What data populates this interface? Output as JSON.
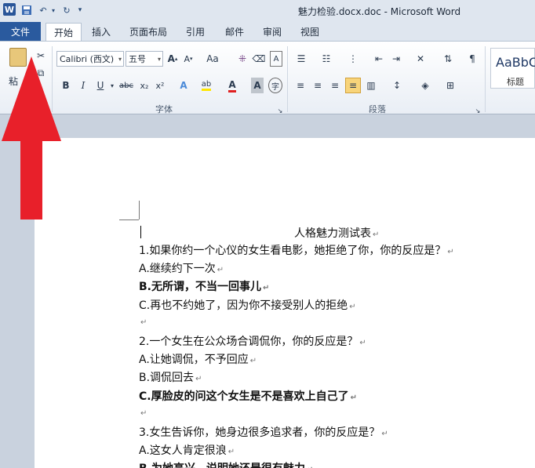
{
  "window": {
    "title": "魅力检验.docx.doc - Microsoft Word",
    "logo_letter": "W"
  },
  "tabs": {
    "file": "文件",
    "items": [
      "开始",
      "插入",
      "页面布局",
      "引用",
      "邮件",
      "审阅",
      "视图"
    ],
    "active": "开始"
  },
  "ribbon": {
    "paste_label": "粘",
    "font_name": "Calibri (西文)",
    "font_size": "五号",
    "font_group_label": "字体",
    "paragraph_group_label": "段落",
    "styles_sample": "AaBbC",
    "style_name": "标题",
    "font_size_grow": "A",
    "font_size_shrink": "A",
    "change_case": "Aa",
    "bold": "B",
    "italic": "I",
    "underline": "U",
    "strikethrough": "abc",
    "subscript": "x₂",
    "superscript": "x²"
  },
  "document": {
    "title": "人格魅力测试表",
    "lines": [
      {
        "text": "1.如果你约一个心仪的女生看电影，她拒绝了你，你的反应是？",
        "bold": false
      },
      {
        "text": "A.继续约下一次",
        "bold": false
      },
      {
        "text": "B.无所谓，不当一回事儿",
        "bold": true
      },
      {
        "text": "C.再也不约她了，因为你不接受别人的拒绝",
        "bold": false
      },
      {
        "text": "",
        "bold": false
      },
      {
        "text": "2.一个女生在公众场合调侃你，你的反应是？",
        "bold": false
      },
      {
        "text": "A.让她调侃，不予回应",
        "bold": false
      },
      {
        "text": "B.调侃回去",
        "bold": false
      },
      {
        "text": "C.厚脸皮的问这个女生是不是喜欢上自己了",
        "bold": true
      },
      {
        "text": "",
        "bold": false
      },
      {
        "text": "3.女生告诉你，她身边很多追求者，你的反应是？",
        "bold": false
      },
      {
        "text": "A.这女人肯定很浪",
        "bold": false
      },
      {
        "text": "B.为她高兴，说明她还是很有魅力",
        "bold": true
      }
    ],
    "paragraph_mark": "↵"
  },
  "colors": {
    "accent": "#2a5a9e",
    "arrow": "#e8202a"
  }
}
